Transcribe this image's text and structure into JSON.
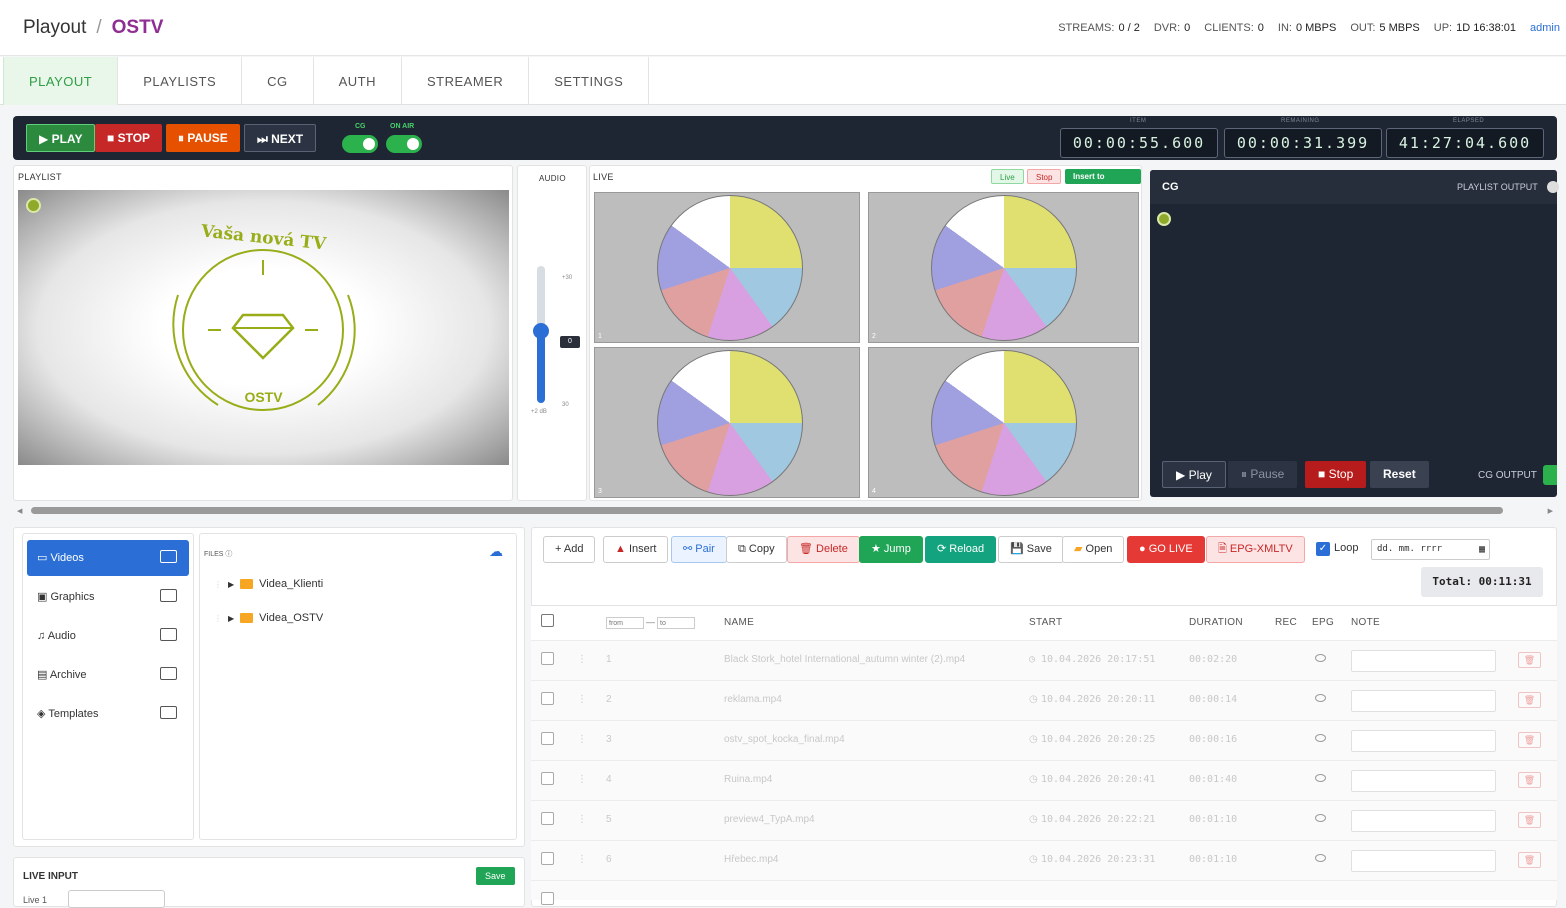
{
  "header": {
    "app": "Playout",
    "channel": "OSTV",
    "stats": [
      {
        "label": "STREAMS:",
        "value": "0 / 2"
      },
      {
        "label": "DVR:",
        "value": "0"
      },
      {
        "label": "CLIENTS:",
        "value": "0"
      },
      {
        "label": "IN:",
        "value": "0 MBPS"
      },
      {
        "label": "OUT:",
        "value": "5 MBPS"
      },
      {
        "label": "UP:",
        "value": "1D 16:38:01"
      }
    ],
    "user": "admin"
  },
  "tabs": [
    "PLAYOUT",
    "PLAYLISTS",
    "CG",
    "AUTH",
    "STREAMER",
    "SETTINGS"
  ],
  "controls": {
    "play": "▶ PLAY",
    "stop": "■ STOP",
    "pause": "⏸ PAUSE",
    "next": "⏭ NEXT",
    "cg_label": "CG",
    "onair_label": "ON AIR",
    "timecodes": [
      {
        "label": "ITEM",
        "value": "00:00:55.600"
      },
      {
        "label": "REMAINING",
        "value": "00:00:31.399"
      },
      {
        "label": "ELAPSED",
        "value": "41:27:04.600"
      }
    ]
  },
  "playlist_preview": {
    "label": "PLAYLIST",
    "logo_top": "Vaša nová TV",
    "logo_bottom": "OSTV"
  },
  "audio": {
    "label": "AUDIO",
    "max": "+30",
    "min": "30",
    "value": "0",
    "db": "+2 dB"
  },
  "live": {
    "label": "LIVE",
    "btn_live": "Live",
    "btn_stop": "Stop",
    "btn_insert": "Insert to Playlist",
    "tiles": [
      "1",
      "2",
      "3",
      "4"
    ]
  },
  "cg": {
    "label": "CG",
    "playlist_output": "PLAYLIST OUTPUT",
    "cg_output": "CG OUTPUT",
    "play": "▶ Play",
    "pause": "⏸ Pause",
    "stop": "■ Stop",
    "reset": "Reset"
  },
  "library": {
    "items": [
      "Videos",
      "Graphics",
      "Audio",
      "Archive",
      "Templates"
    ],
    "files_label": "FILES ⓘ",
    "folders": [
      "Videa_Klienti",
      "Videa_OSTV"
    ]
  },
  "toolbar": {
    "add": "+ Add",
    "insert": "Insert",
    "pair": "Pair",
    "copy": "Copy",
    "delete": "Delete",
    "jump": "Jump",
    "reload": "Reload",
    "save": "Save",
    "open": "Open",
    "golive": "GO LIVE",
    "epg": "EPG-XMLTV",
    "loop": "Loop",
    "date": "dd. mm. rrrr",
    "total": "Total: 00:11:31"
  },
  "table": {
    "from_placeholder": "from",
    "to_placeholder": "to",
    "headers": [
      "NAME",
      "START",
      "DURATION",
      "REC",
      "EPG",
      "NOTE"
    ],
    "rows": [
      {
        "n": "1",
        "name": "Black Stork_hotel International_autumn winter (2).mp4",
        "start": "10.04.2026 20:17:51",
        "dur": "00:02:20"
      },
      {
        "n": "2",
        "name": "reklama.mp4",
        "start": "10.04.2026 20:20:11",
        "dur": "00:00:14"
      },
      {
        "n": "3",
        "name": "ostv_spot_kocka_final.mp4",
        "start": "10.04.2026 20:20:25",
        "dur": "00:00:16"
      },
      {
        "n": "4",
        "name": "Ruina.mp4",
        "start": "10.04.2026 20:20:41",
        "dur": "00:01:40"
      },
      {
        "n": "5",
        "name": "preview4_TypA.mp4",
        "start": "10.04.2026 20:22:21",
        "dur": "00:01:10"
      },
      {
        "n": "6",
        "name": "Hřebec.mp4",
        "start": "10.04.2026 20:23:31",
        "dur": "00:01:10"
      }
    ]
  },
  "live_input": {
    "label": "LIVE INPUT",
    "save": "Save",
    "live1": "Live 1"
  },
  "colors": {
    "accent": "#2f9e44",
    "brand": "#8e2e92",
    "blue": "#2b6fd6",
    "red": "#c62828",
    "orange": "#e65100",
    "dark": "#1f2633"
  }
}
